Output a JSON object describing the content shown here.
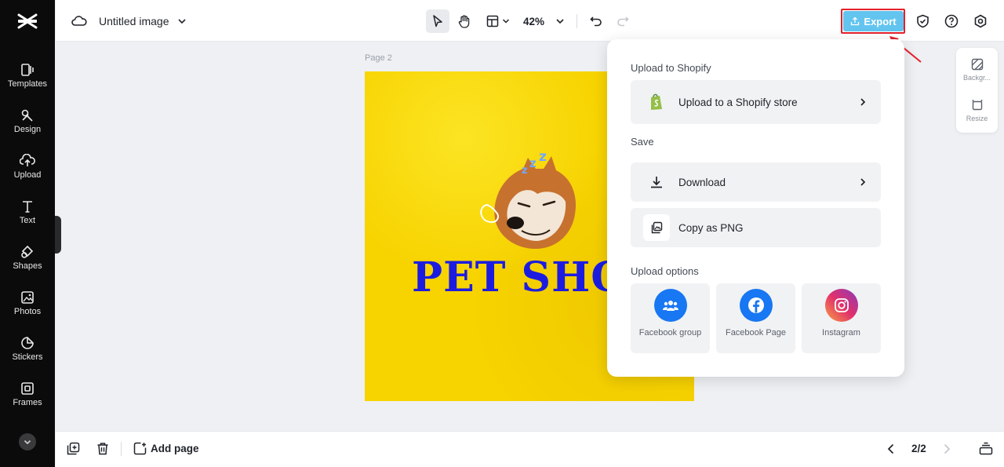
{
  "sidebar": {
    "items": [
      {
        "label": "Templates",
        "icon": "templates-icon"
      },
      {
        "label": "Design",
        "icon": "design-icon"
      },
      {
        "label": "Upload",
        "icon": "upload-icon"
      },
      {
        "label": "Text",
        "icon": "text-icon"
      },
      {
        "label": "Shapes",
        "icon": "shapes-icon"
      },
      {
        "label": "Photos",
        "icon": "photos-icon"
      },
      {
        "label": "Stickers",
        "icon": "stickers-icon"
      },
      {
        "label": "Frames",
        "icon": "frames-icon"
      }
    ]
  },
  "topbar": {
    "title": "Untitled image",
    "zoom": "42%",
    "export_label": "Export"
  },
  "canvas": {
    "page_label": "Page 2",
    "headline": "PET SHO"
  },
  "right_panel": {
    "background_label": "Backgr...",
    "resize_label": "Resize"
  },
  "export_menu": {
    "shopify_title": "Upload to Shopify",
    "shopify_row": "Upload to a Shopify store",
    "save_title": "Save",
    "download_row": "Download",
    "copy_row": "Copy as PNG",
    "upload_options_title": "Upload options",
    "tiles": [
      {
        "label": "Facebook group",
        "icon": "facebook-group-icon",
        "color": "#1877f2"
      },
      {
        "label": "Facebook Page",
        "icon": "facebook-icon",
        "color": "#1877f2"
      },
      {
        "label": "Instagram",
        "icon": "instagram-icon",
        "color": "#e1306c"
      }
    ]
  },
  "bottombar": {
    "add_page_label": "Add page",
    "pager": "2/2"
  },
  "colors": {
    "accent": "#63c5ef",
    "highlight": "#e5202c",
    "canvas_bg": "#f7d300",
    "headline": "#1c1ce0"
  }
}
